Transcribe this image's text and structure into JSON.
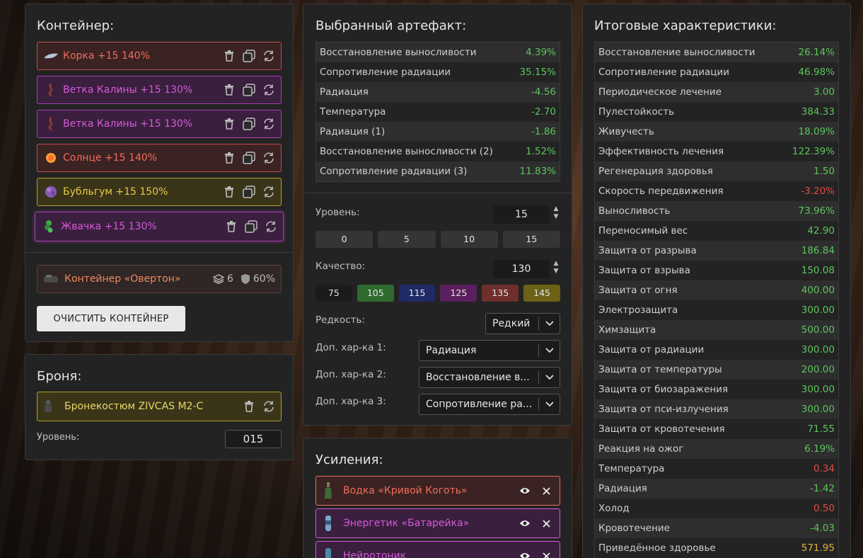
{
  "container": {
    "title": "Контейнер:",
    "artifacts": [
      {
        "name": "Корка +15 140%",
        "color": "red",
        "icon": "crust-icon"
      },
      {
        "name": "Ветка Калины +15 130%",
        "color": "purple",
        "icon": "branch-icon"
      },
      {
        "name": "Ветка Калины +15 130%",
        "color": "purple",
        "icon": "branch-icon"
      },
      {
        "name": "Солнце +15 140%",
        "color": "red",
        "icon": "sun-icon"
      },
      {
        "name": "Бубльгум +15 150%",
        "color": "yellow",
        "icon": "bubblegum-icon"
      },
      {
        "name": "Жвачка +15 130%",
        "color": "purple",
        "icon": "gum-icon"
      }
    ],
    "container_item": {
      "name": "Контейнер «Овертон»",
      "slots": "6",
      "protection": "60%"
    },
    "clear_button": "ОЧИСТИТЬ КОНТЕЙНЕР"
  },
  "armor": {
    "title": "Броня:",
    "item": "Бронекостюм ZIVCAS M2-C",
    "level_label": "Уровень:",
    "level_value": "015"
  },
  "artifact": {
    "title": "Выбранный артефакт:",
    "stats": [
      {
        "name": "Восстановление выносливости",
        "value": "4.39%",
        "tone": "pos"
      },
      {
        "name": "Сопротивление радиации",
        "value": "35.15%",
        "tone": "pos"
      },
      {
        "name": "Радиация",
        "value": "-4.56",
        "tone": "pos"
      },
      {
        "name": "Температура",
        "value": "-2.70",
        "tone": "pos"
      },
      {
        "name": "Радиация (1)",
        "value": "-1.86",
        "tone": "pos"
      },
      {
        "name": "Восстановление выносливости (2)",
        "value": "1.52%",
        "tone": "pos"
      },
      {
        "name": "Сопротивление радиации (3)",
        "value": "11.83%",
        "tone": "pos"
      }
    ],
    "level_label": "Уровень:",
    "level_value": "15",
    "level_presets": [
      "0",
      "5",
      "10",
      "15"
    ],
    "quality_label": "Качество:",
    "quality_value": "130",
    "quality_presets": [
      {
        "label": "75",
        "color": "#1b1b1b"
      },
      {
        "label": "105",
        "color": "#2f6b2f"
      },
      {
        "label": "115",
        "color": "#1f2a66"
      },
      {
        "label": "125",
        "color": "#5a1f5e"
      },
      {
        "label": "135",
        "color": "#6e2e2b"
      },
      {
        "label": "145",
        "color": "#6b6218"
      }
    ],
    "rarity_label": "Редкость:",
    "rarity_value": "Редкий",
    "extra1_label": "Доп. хар-ка 1:",
    "extra1_value": "Радиация",
    "extra2_label": "Доп. хар-ка 2:",
    "extra2_value": "Восстановление в...",
    "extra3_label": "Доп. хар-ка 3:",
    "extra3_value": "Сопротивление ра..."
  },
  "boosts": {
    "title": "Усиления:",
    "items": [
      {
        "name": "Водка «Кривой Коготь»",
        "color": "red"
      },
      {
        "name": "Энергетик «Батарейка»",
        "color": "purple"
      },
      {
        "name": "Нейротоник",
        "color": "purple"
      }
    ]
  },
  "totals": {
    "title": "Итоговые характеристики:",
    "stats": [
      {
        "name": "Восстановление выносливости",
        "value": "26.14%",
        "tone": "pos"
      },
      {
        "name": "Сопротивление радиации",
        "value": "46.98%",
        "tone": "pos"
      },
      {
        "name": "Периодическое лечение",
        "value": "3.00",
        "tone": "pos"
      },
      {
        "name": "Пулестойкость",
        "value": "384.33",
        "tone": "pos"
      },
      {
        "name": "Живучесть",
        "value": "18.09%",
        "tone": "pos"
      },
      {
        "name": "Эффективность лечения",
        "value": "122.39%",
        "tone": "pos"
      },
      {
        "name": "Регенерация здоровья",
        "value": "1.50",
        "tone": "pos"
      },
      {
        "name": "Скорость передвижения",
        "value": "-3.20%",
        "tone": "neg"
      },
      {
        "name": "Выносливость",
        "value": "73.96%",
        "tone": "pos"
      },
      {
        "name": "Переносимый вес",
        "value": "42.90",
        "tone": "pos"
      },
      {
        "name": "Защита от разрыва",
        "value": "186.84",
        "tone": "pos"
      },
      {
        "name": "Защита от взрыва",
        "value": "150.08",
        "tone": "pos"
      },
      {
        "name": "Защита от огня",
        "value": "400.00",
        "tone": "pos"
      },
      {
        "name": "Электрозащита",
        "value": "300.00",
        "tone": "pos"
      },
      {
        "name": "Химзащита",
        "value": "500.00",
        "tone": "pos"
      },
      {
        "name": "Защита от радиации",
        "value": "300.00",
        "tone": "pos"
      },
      {
        "name": "Защита от температуры",
        "value": "200.00",
        "tone": "pos"
      },
      {
        "name": "Защита от биозаражения",
        "value": "300.00",
        "tone": "pos"
      },
      {
        "name": "Защита от пси-излучения",
        "value": "300.00",
        "tone": "pos"
      },
      {
        "name": "Защита от кровотечения",
        "value": "71.55",
        "tone": "pos"
      },
      {
        "name": "Реакция на ожог",
        "value": "6.19%",
        "tone": "pos"
      },
      {
        "name": "Температура",
        "value": "0.34",
        "tone": "neg"
      },
      {
        "name": "Радиация",
        "value": "-1.42",
        "tone": "pos"
      },
      {
        "name": "Холод",
        "value": "0.50",
        "tone": "neg"
      },
      {
        "name": "Кровотечение",
        "value": "-4.03",
        "tone": "pos"
      },
      {
        "name": "Приведённое здоровье",
        "value": "571.95",
        "tone": "gold"
      }
    ]
  }
}
